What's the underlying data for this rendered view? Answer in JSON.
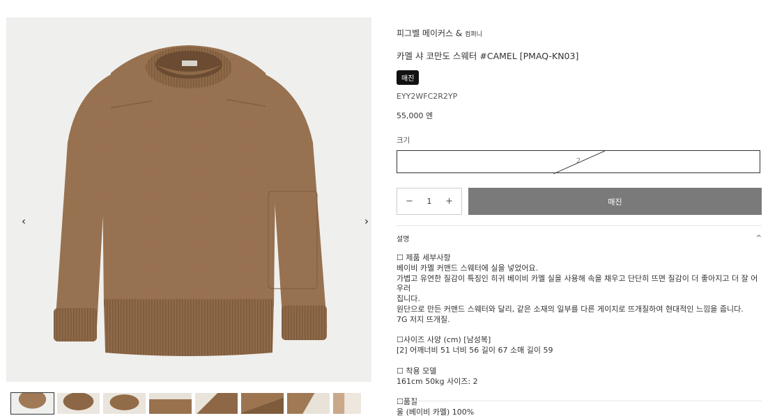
{
  "gallery": {
    "prev_icon": "chevron-left-icon",
    "next_icon": "chevron-right-icon",
    "prev_glyph": "‹",
    "next_glyph": "›",
    "thumbnail_count": 8
  },
  "product": {
    "brand": "피그벨 메이커스 &",
    "brand_sub": "컴퍼니",
    "title": "카멜 샤 코만도 스웨터 #CAMEL [PMAQ-KN03]",
    "badge": "매진",
    "sku": "EYY2WFC2R2YP",
    "price": "55,000 엔"
  },
  "size": {
    "label": "크기",
    "value": "2"
  },
  "quantity": {
    "value": "1",
    "minus": "−",
    "plus": "+"
  },
  "buy_button": {
    "label": "매진"
  },
  "description": {
    "heading": "설명",
    "chevron": "^",
    "lines": [
      "☐ 제품 세부사항",
      "베이비 카멜 커맨드 스웨터에 실을 넣었어요.",
      "가볍고 유연한 질감이 특징인 히귀 베이비 카멜 실을 사용해 속을 채우고 단단히 뜨면 질감이 더 좋아지고 더 잘 어우러",
      "집니다.",
      "원단으로 만든 커맨드 스웨터와 달리, 같은 소재의 일부를 다른 게이지로 뜨개질하여 현대적인 느낌을 줍니다.",
      "7G 저지 뜨개질.",
      "",
      "☐사이즈 사양 (cm) [남성복]",
      "[2] 어깨너비 51 너비 56 길이 67 소매 길이 59",
      "",
      "☐ 착용 모델",
      "161cm 50kg 사이즈: 2",
      "",
      "☐품질",
      "울 (베이비 카멜) 100%"
    ]
  },
  "colors": {
    "sweater": "#9a7452",
    "badge_bg": "#111111",
    "button_bg": "#7a7a7a"
  }
}
